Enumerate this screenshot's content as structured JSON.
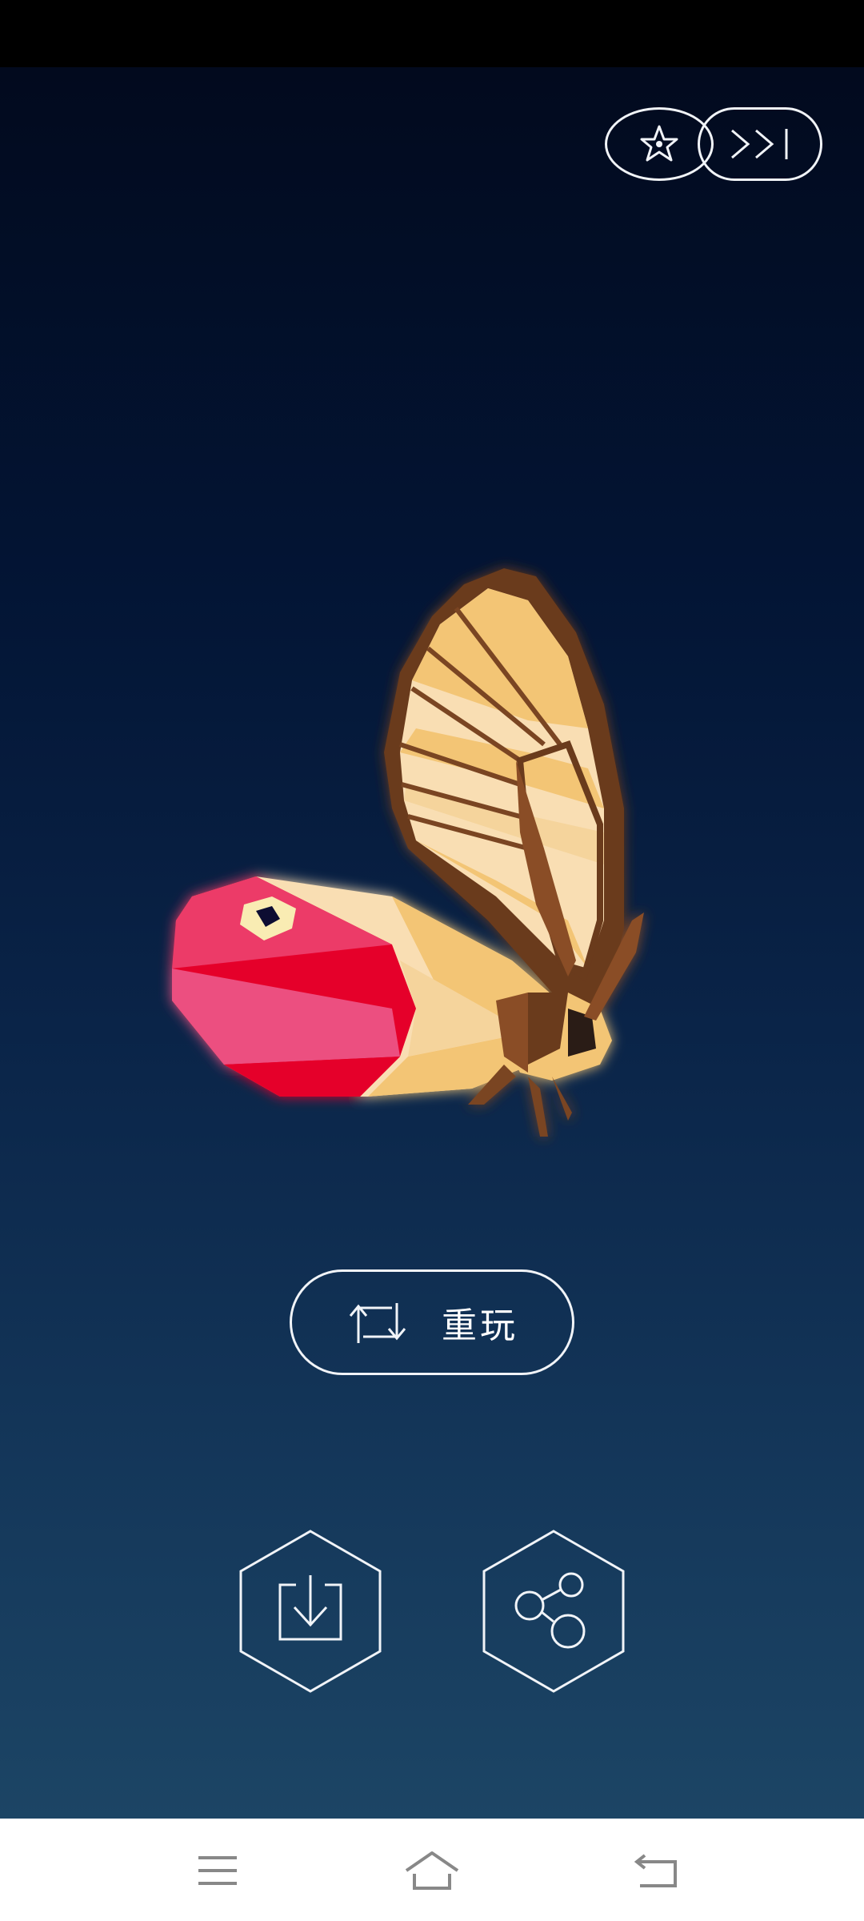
{
  "top_controls": {
    "hint_icon": "star-badge-icon",
    "skip_icon": "skip-forward-icon"
  },
  "replay": {
    "label": "重玩",
    "icon": "replay-arrows-icon"
  },
  "actions": {
    "download_icon": "download-icon",
    "share_icon": "share-icon"
  },
  "nav": {
    "menu_icon": "menu-icon",
    "home_icon": "home-icon",
    "back_icon": "back-icon"
  },
  "colors": {
    "background_top": "#020a1e",
    "background_bottom": "#1c4565",
    "outline": "#f1f4f8",
    "wing_red": "#e5002a",
    "wing_pink": "#ec5080",
    "wing_cream": "#f9deb3",
    "wing_orange": "#f3c575",
    "wing_brown": "#6b3a1d"
  }
}
